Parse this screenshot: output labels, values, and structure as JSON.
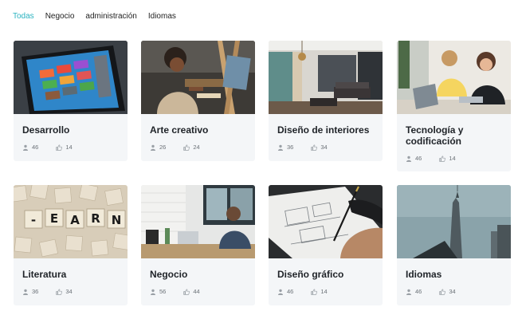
{
  "filters": [
    {
      "label": "Todas",
      "active": true
    },
    {
      "label": "Negocio",
      "active": false
    },
    {
      "label": "administración",
      "active": false
    },
    {
      "label": "Idiomas",
      "active": false
    }
  ],
  "cards": [
    {
      "title": "Desarrollo",
      "users": "46",
      "likes": "14",
      "image": "tablet-apps"
    },
    {
      "title": "Arte creativo",
      "users": "26",
      "likes": "24",
      "image": "painter-easel"
    },
    {
      "title": "Diseño de interiores",
      "users": "36",
      "likes": "34",
      "image": "living-room"
    },
    {
      "title": "Tecnología y codificación",
      "users": "46",
      "likes": "14",
      "image": "women-laptop"
    },
    {
      "title": "Literatura",
      "users": "36",
      "likes": "34",
      "image": "scrabble-tiles"
    },
    {
      "title": "Negocio",
      "users": "56",
      "likes": "44",
      "image": "man-desk"
    },
    {
      "title": "Diseño gráfico",
      "users": "46",
      "likes": "14",
      "image": "sketch-drawing"
    },
    {
      "title": "Idiomas",
      "users": "46",
      "likes": "34",
      "image": "skyscraper"
    }
  ],
  "icons": {
    "users": "user-icon",
    "likes": "thumbs-up-icon"
  },
  "colors": {
    "accent": "#2bb3c0",
    "card_bg": "#f4f6f8",
    "title": "#1f2328",
    "meta": "#6c7278"
  }
}
